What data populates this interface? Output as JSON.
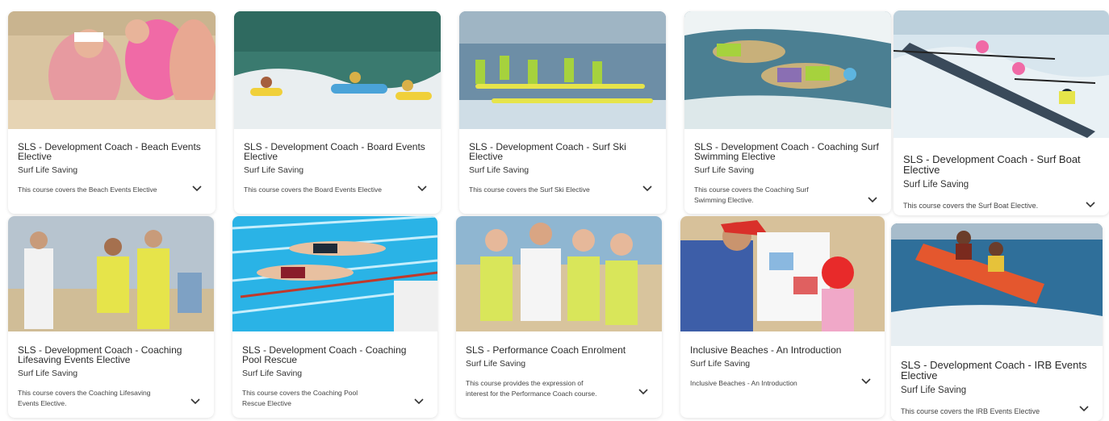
{
  "cards": [
    {
      "title": "SLS - Development Coach - Beach Events Elective",
      "provider": "Surf Life Saving",
      "description": "This course covers the Beach Events Elective",
      "image_subject": "beach-sprint-athletes"
    },
    {
      "title": "SLS - Development Coach - Board Events Elective",
      "provider": "Surf Life Saving",
      "description": "This course covers the Board Events Elective",
      "image_subject": "board-paddlers"
    },
    {
      "title": "SLS - Development Coach - Surf Ski Elective",
      "provider": "Surf Life Saving",
      "description": "This course covers the Surf Ski Elective",
      "image_subject": "surf-ski-start"
    },
    {
      "title": "SLS - Development Coach - Coaching Surf Swimming Elective",
      "provider": "Surf Life Saving",
      "description": "This course covers the Coaching Surf Swimming Elective.",
      "image_subject": "surf-swimmers-diving"
    },
    {
      "title": "SLS - Development Coach - Surf Boat Elective",
      "provider": "Surf Life Saving",
      "description": "This course covers the Surf Boat Elective.",
      "image_subject": "surf-boat-rowers"
    },
    {
      "title": "SLS - Development Coach - Coaching Lifesaving Events Elective",
      "provider": "Surf Life Saving",
      "description": "This course covers the Coaching Lifesaving Events Elective.",
      "image_subject": "officials-on-beach"
    },
    {
      "title": "SLS - Development Coach - Coaching Pool Rescue",
      "provider": "Surf Life Saving",
      "description": "This course covers the Coaching Pool Rescue Elective",
      "image_subject": "pool-dive-start"
    },
    {
      "title": "SLS - Performance Coach Enrolment",
      "provider": "Surf Life Saving",
      "description": "This course provides the expression of interest for the Performance Coach course.",
      "image_subject": "athletes-group-photo"
    },
    {
      "title": "Inclusive Beaches - An Introduction",
      "provider": "Surf Life Saving",
      "description": "Inclusive Beaches - An Introduction",
      "image_subject": "instructor-with-child"
    },
    {
      "title": "SLS - Development Coach - IRB Events Elective",
      "provider": "Surf Life Saving",
      "description": "This course covers the IRB Events Elective",
      "image_subject": "irb-rescue-boat"
    }
  ],
  "icons": {
    "expand": "chevron-down-icon"
  },
  "colors": {
    "ocean": "#2f6f9a",
    "sand": "#d9c4a0",
    "cap_yellow": "#e6e44a",
    "cap_pink": "#f06aa6",
    "pool": "#2ab3e6",
    "irb_orange": "#e4572e"
  }
}
